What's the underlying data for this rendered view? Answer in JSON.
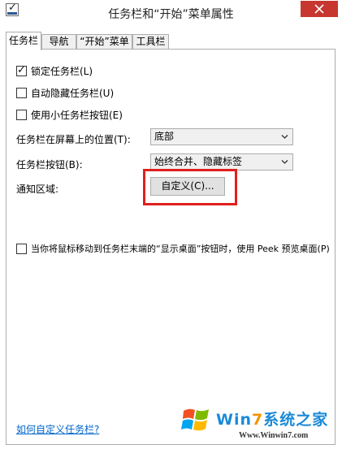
{
  "window": {
    "title": "任务栏和“开始”菜单属性",
    "close_glyph": "✕"
  },
  "tabs": [
    {
      "label": "任务栏",
      "active": true
    },
    {
      "label": "导航",
      "active": false
    },
    {
      "label": "“开始”菜单",
      "active": false
    },
    {
      "label": "工具栏",
      "active": false
    }
  ],
  "options": {
    "lock_taskbar": {
      "label": "锁定任务栏(L)",
      "checked": true
    },
    "auto_hide": {
      "label": "自动隐藏任务栏(U)",
      "checked": false
    },
    "small_buttons": {
      "label": "使用小任务栏按钮(E)",
      "checked": false
    }
  },
  "location": {
    "label": "任务栏在屏幕上的位置(T):",
    "value": "底部"
  },
  "buttons_setting": {
    "label": "任务栏按钮(B):",
    "value": "始终合并、隐藏标签"
  },
  "notification_area": {
    "label": "通知区域:",
    "customize_label": "自定义(C)..."
  },
  "peek": {
    "label": "当你将鼠标移动到任务栏末端的“显示桌面”按钮时，使用 Peek 预览桌面(P)",
    "checked": false
  },
  "help_link": "如何自定义任务栏?",
  "watermark": {
    "brand": "Win7系统之家",
    "url": "Www.Winwin7.com"
  },
  "colors": {
    "close_button": "#c7372f",
    "highlight_border": "#e0201e",
    "link": "#0066cc"
  },
  "icons": [
    "app-icon",
    "close-icon",
    "checkbox-check-icon",
    "dropdown-caret-icon",
    "windows-logo"
  ]
}
